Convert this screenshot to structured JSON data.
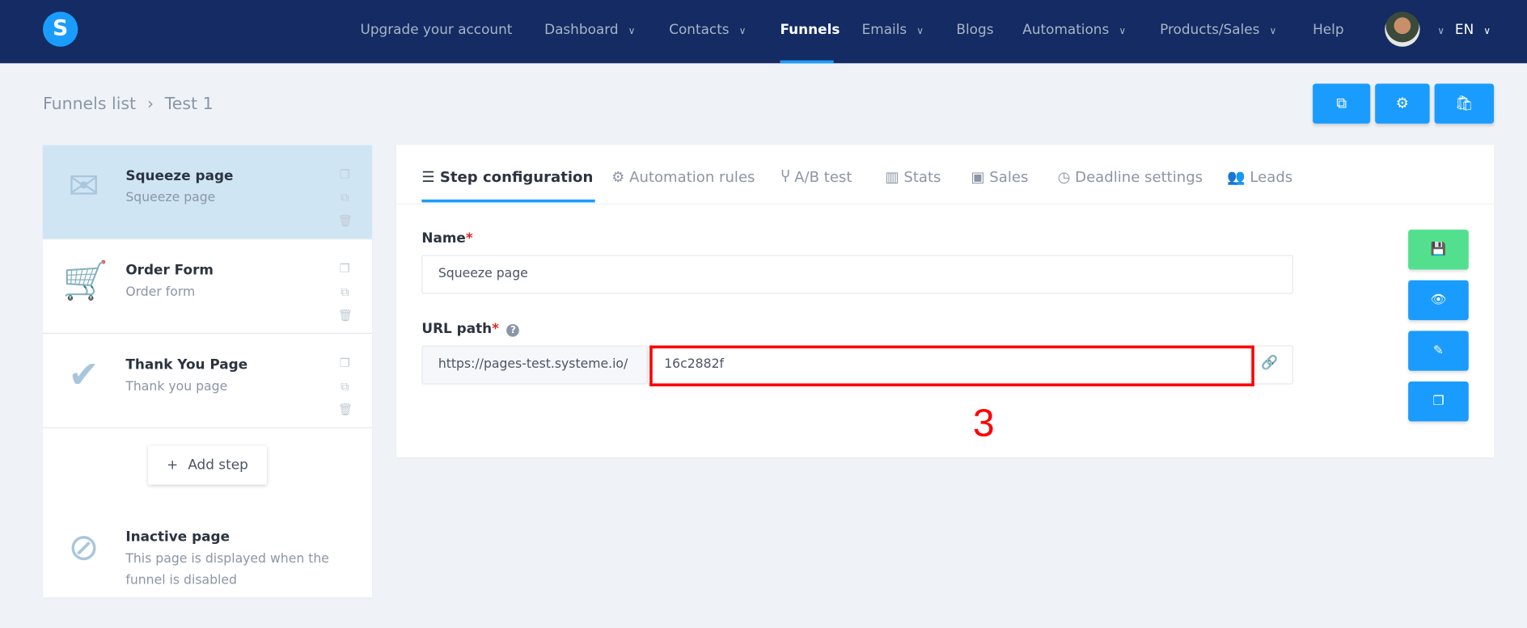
{
  "nav": {
    "logo": "S",
    "items": [
      {
        "label": "Upgrade your account"
      },
      {
        "label": "Dashboard",
        "dropdown": true
      },
      {
        "label": "Contacts",
        "dropdown": true
      },
      {
        "label": "Funnels",
        "active": true
      },
      {
        "label": "Emails",
        "dropdown": true
      },
      {
        "label": "Blogs"
      },
      {
        "label": "Automations",
        "dropdown": true
      },
      {
        "label": "Products/Sales",
        "dropdown": true
      },
      {
        "label": "Help"
      }
    ],
    "language": "EN"
  },
  "breadcrumb": {
    "parent": "Funnels list",
    "separator": "›",
    "current": "Test 1"
  },
  "steps": [
    {
      "title": "Squeeze page",
      "subtitle": "Squeeze page",
      "icon": "envelope-icon",
      "selected": true
    },
    {
      "title": "Order Form",
      "subtitle": "Order form",
      "icon": "cart-icon"
    },
    {
      "title": "Thank You Page",
      "subtitle": "Thank you page",
      "icon": "check-icon"
    }
  ],
  "add_step": "Add step",
  "inactive": {
    "title": "Inactive page",
    "line1": "This page is displayed when the",
    "line2": "funnel is disabled"
  },
  "tabs": [
    "Step configuration",
    "Automation rules",
    "A/B test",
    "Stats",
    "Sales",
    "Deadline settings",
    "Leads"
  ],
  "form": {
    "name_label": "Name",
    "required": "*",
    "name_value": "Squeeze page",
    "url_label": "URL path",
    "url_prefix": "https://pages-test.systeme.io/",
    "url_value": "16c2882f"
  },
  "annotation": "3",
  "colors": {
    "nav": "#142c63",
    "accent": "#1a9cff",
    "save": "#52e08f",
    "annotation": "#ff0000"
  }
}
